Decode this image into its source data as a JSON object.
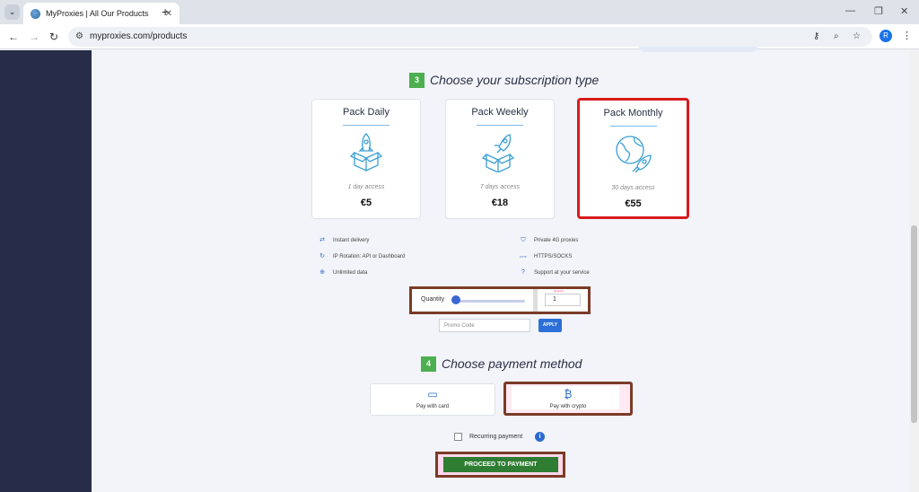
{
  "browser": {
    "tab_title": "MyProxies | All Our Products",
    "url": "myproxies.com/products",
    "profile_initial": "R"
  },
  "step3": {
    "num": "3",
    "title": "Choose your subscription type"
  },
  "plans": [
    {
      "name": "Pack Daily",
      "access": "1 day access",
      "price": "€5",
      "selected": false,
      "icon": "rocket-box-icon"
    },
    {
      "name": "Pack Weekly",
      "access": "7 days access",
      "price": "€18",
      "selected": false,
      "icon": "rocket-box-icon"
    },
    {
      "name": "Pack Monthly",
      "access": "30 days access",
      "price": "€55",
      "selected": true,
      "icon": "globe-rocket-icon"
    }
  ],
  "features": {
    "left": [
      "Instant delivery",
      "IP Rotation: API or Dashboard",
      "Unlimited data"
    ],
    "right": [
      "Private 4G proxies",
      "HTTPS/SOCKS",
      "Support at your service"
    ]
  },
  "quantity": {
    "label": "Quantity",
    "value": "1",
    "tiny": "Quantity"
  },
  "promo": {
    "placeholder": "Promo Code",
    "apply": "APPLY"
  },
  "step4": {
    "num": "4",
    "title": "Choose payment method"
  },
  "payment": {
    "card": "Pay with card",
    "crypto": "Pay with crypto",
    "selected": "crypto"
  },
  "recurring": {
    "label": "Recurring payment",
    "info": "i"
  },
  "proceed": "PROCEED TO PAYMENT"
}
